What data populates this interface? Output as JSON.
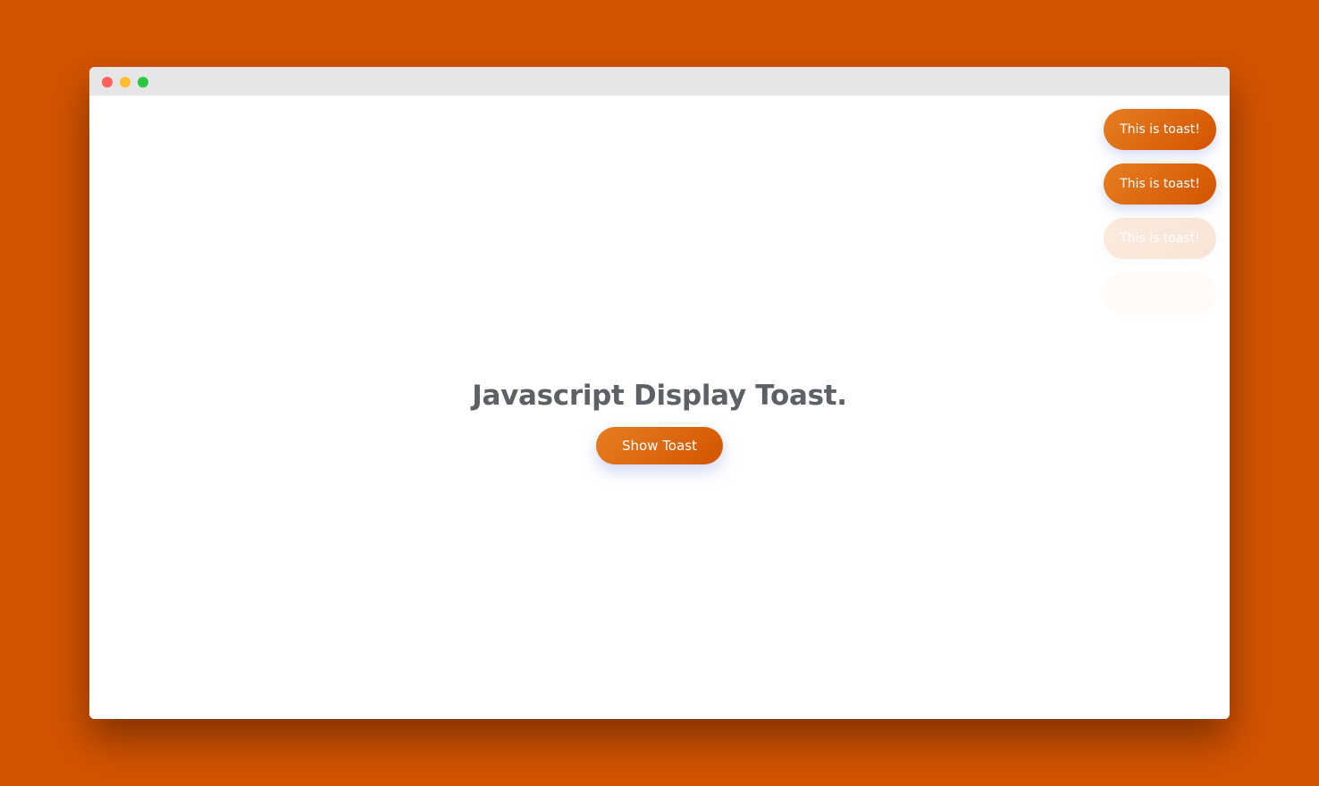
{
  "window": {
    "controls": [
      "close",
      "minimize",
      "maximize"
    ]
  },
  "main": {
    "heading": "Javascript Display Toast.",
    "show_button_label": "Show Toast"
  },
  "toasts": [
    {
      "text": "This is toast!"
    },
    {
      "text": "This is toast!"
    },
    {
      "text": "This is toast!"
    },
    {
      "text": ""
    }
  ],
  "colors": {
    "background": "#d35400",
    "accent_start": "#e67e22",
    "accent_end": "#d35400",
    "heading_text": "#5d6166"
  }
}
